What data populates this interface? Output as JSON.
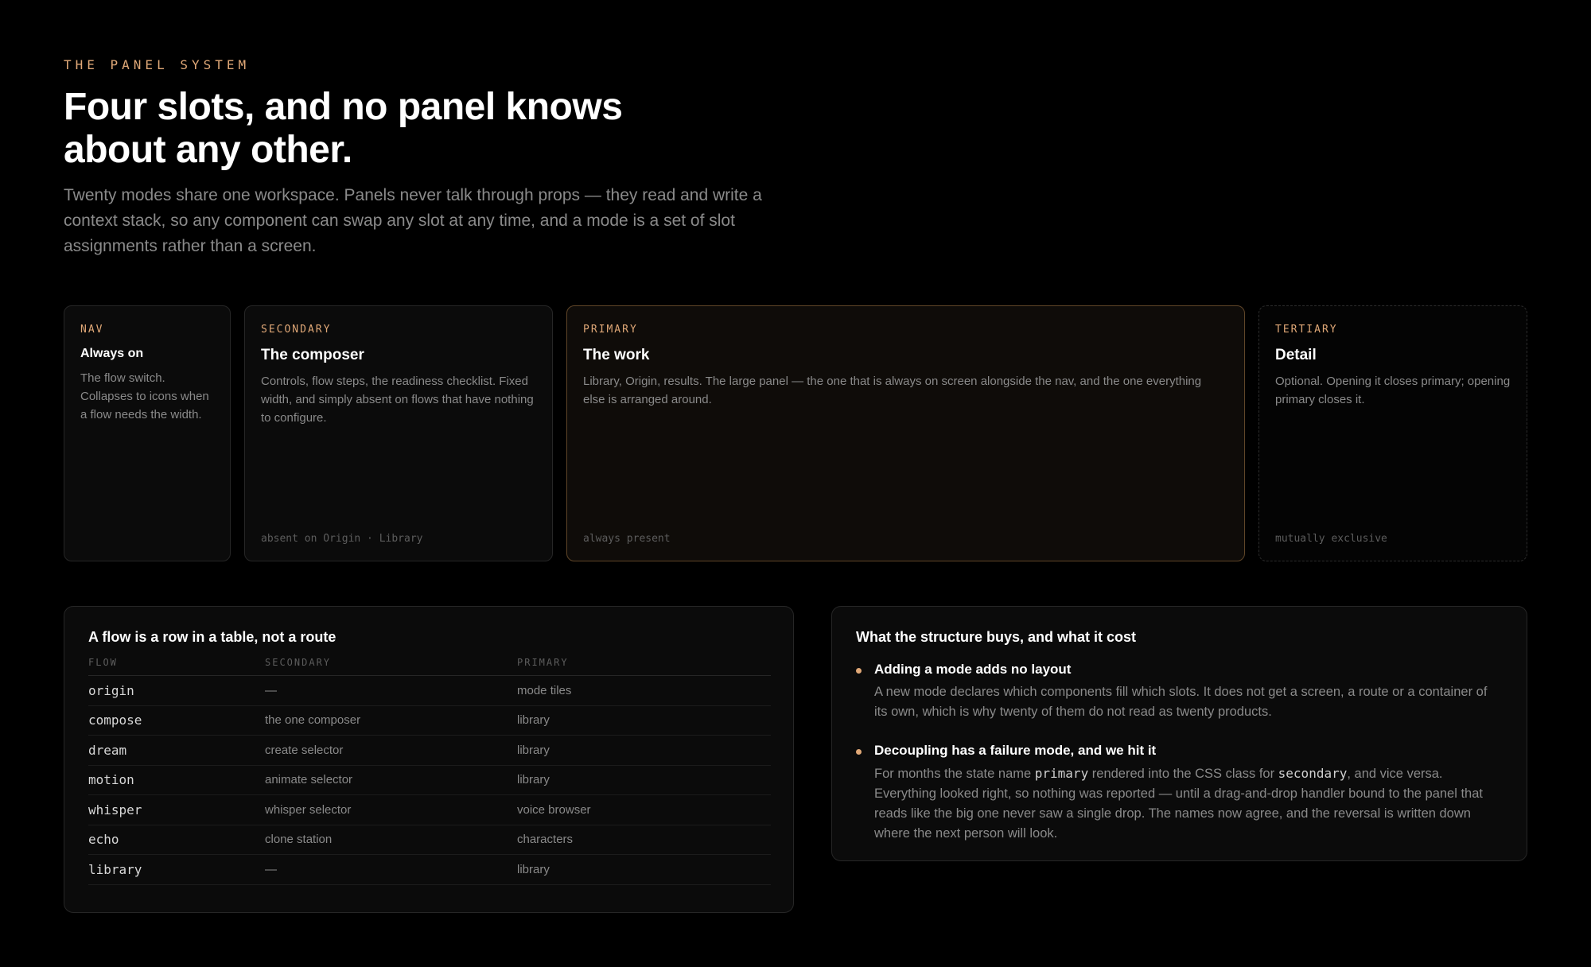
{
  "header": {
    "eyebrow": "THE PANEL SYSTEM",
    "title": "Four slots, and no panel knows about any other.",
    "intro": "Twenty modes share one workspace. Panels never talk through props — they read and write a context stack, so any component can swap any slot at any time, and a mode is a set of slot assignments rather than a screen."
  },
  "panels": {
    "nav": {
      "slot": "NAV",
      "title": "Always on",
      "desc": "The flow switch. Collapses to icons when a flow needs the width."
    },
    "secondary": {
      "slot": "SECONDARY",
      "title": "The composer",
      "desc": "Controls, flow steps, the readiness checklist. Fixed width, and simply absent on flows that have nothing to configure.",
      "foot": "absent on Origin · Library"
    },
    "primary": {
      "slot": "PRIMARY",
      "title": "The work",
      "desc": "Library, Origin, results. The large panel — the one that is always on screen alongside the nav, and the one everything else is arranged around.",
      "foot": "always present"
    },
    "tertiary": {
      "slot": "TERTIARY",
      "title": "Detail",
      "desc": "Optional. Opening it closes primary; opening primary closes it.",
      "foot": "mutually exclusive"
    }
  },
  "flows": {
    "title": "A flow is a row in a table, not a route",
    "columns": [
      "FLOW",
      "SECONDARY",
      "PRIMARY"
    ],
    "rows": [
      [
        "origin",
        "—",
        "mode tiles"
      ],
      [
        "compose",
        "the one composer",
        "library"
      ],
      [
        "dream",
        "create selector",
        "library"
      ],
      [
        "motion",
        "animate selector",
        "library"
      ],
      [
        "whisper",
        "whisper selector",
        "voice browser"
      ],
      [
        "echo",
        "clone station",
        "characters"
      ],
      [
        "library",
        "—",
        "library"
      ]
    ]
  },
  "buys": {
    "title": "What the structure buys, and what it cost",
    "b1_head": "Adding a mode adds no layout",
    "b1_body": "A new mode declares which components fill which slots. It does not get a screen, a route or a container of its own, which is why twenty of them do not read as twenty products.",
    "b2_head": "Decoupling has a failure mode, and we hit it",
    "b2_body_1": "For months the state name ",
    "b2_code_1": "primary",
    "b2_body_2": " rendered into the CSS class for ",
    "b2_code_2": "secondary",
    "b2_body_3": ", and vice versa. Everything looked right, so nothing was reported — until a drag-and-drop handler bound to the panel that reads like the big one never saw a single drop. The names now agree, and the reversal is written down where the next person will look."
  },
  "colors": {
    "accent": "#e0a877",
    "background": "#000000",
    "panel": "#0b0b0b",
    "primary_border": "#5f4528",
    "muted_text": "#8a8a8a"
  }
}
